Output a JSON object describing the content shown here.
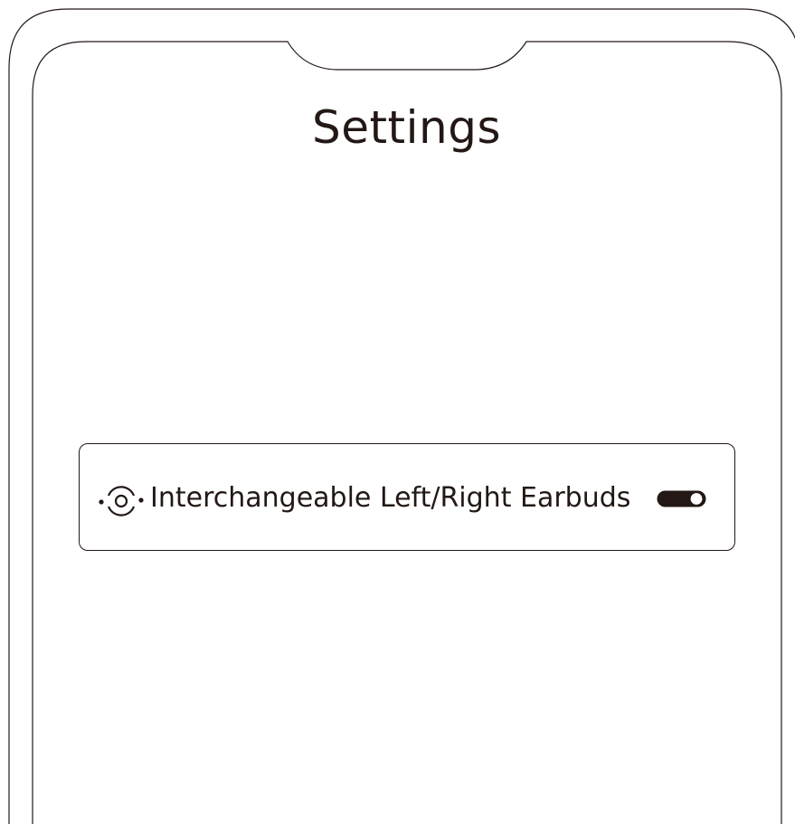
{
  "screen": {
    "title": "Settings"
  },
  "settings": {
    "items": [
      {
        "label": "Interchangeable Left/Right Earbuds",
        "icon": "swap-earbuds-icon",
        "toggle_state": "on"
      }
    ]
  },
  "colors": {
    "ink": "#231815",
    "background": "#ffffff"
  }
}
